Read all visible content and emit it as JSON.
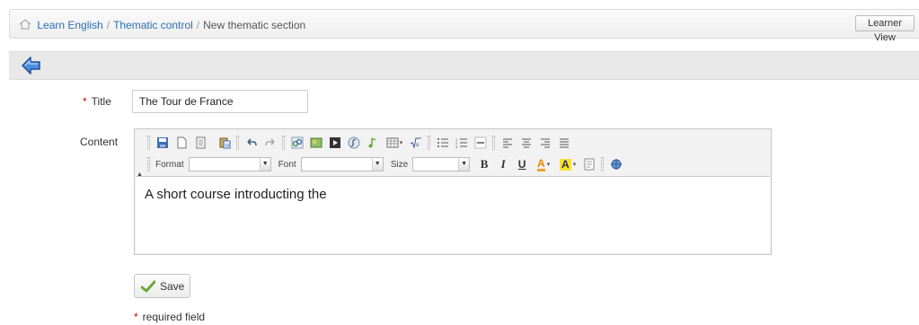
{
  "breadcrumb": {
    "home_icon": "home-icon",
    "items": [
      "Learn English",
      "Thematic control"
    ],
    "separator": "/",
    "current": "New thematic section"
  },
  "header": {
    "learner_view_label": "Learner View"
  },
  "actionbar": {
    "back_icon": "back-arrow-icon"
  },
  "form": {
    "required_marker": "*",
    "title_label": "Title",
    "title_value": "The Tour de France",
    "content_label": "Content",
    "editor": {
      "format_label": "Format",
      "font_label": "Font",
      "size_label": "Size",
      "bold_label": "B",
      "italic_label": "I",
      "underline_label": "U",
      "text_color_label": "A",
      "bg_color_label": "A",
      "content_text": "A short course introducting the"
    },
    "save_label": "Save",
    "required_note": "required field"
  },
  "colors": {
    "link": "#2a6fb5",
    "required": "#cc0000",
    "save_check": "#6aa83a",
    "back_icon": "#2f72c0"
  }
}
